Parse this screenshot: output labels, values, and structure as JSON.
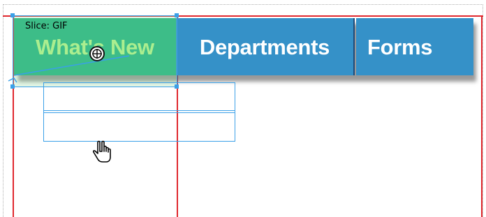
{
  "slice": {
    "label": "Slice: GIF"
  },
  "nav": {
    "buttons": [
      {
        "label": "What's New"
      },
      {
        "label": "Departments"
      },
      {
        "label": "Forms"
      }
    ]
  },
  "colors": {
    "guide": "#e0282e",
    "slice_outline": "#3aa0e8",
    "nav_blue": "#3591c8",
    "whats_new_green": "#23b383",
    "whats_new_text": "#b6f48c"
  },
  "icons": {
    "move": "crosshair-move-icon",
    "pointer": "hand-pointer-icon"
  }
}
